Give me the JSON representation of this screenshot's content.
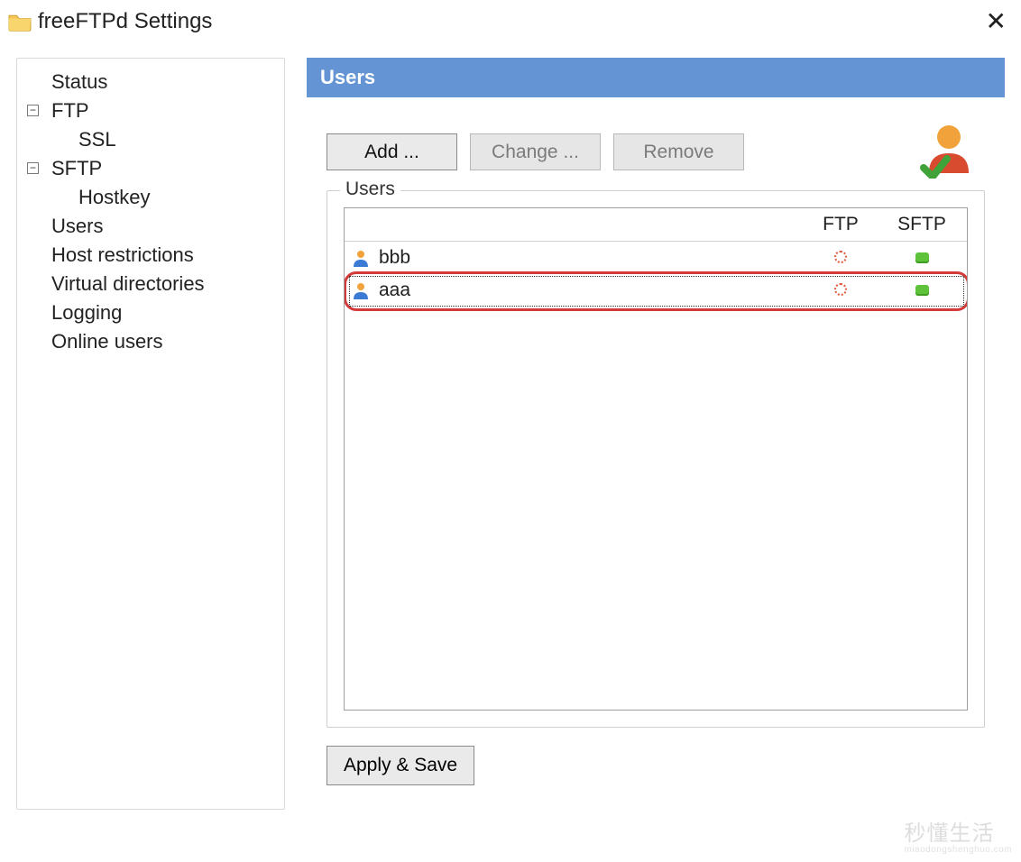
{
  "window": {
    "title": "freeFTPd Settings"
  },
  "sidebar": {
    "items": [
      {
        "label": "Status",
        "depth": 0,
        "expandable": false
      },
      {
        "label": "FTP",
        "depth": 0,
        "expandable": true,
        "expanded": true
      },
      {
        "label": "SSL",
        "depth": 1,
        "expandable": false
      },
      {
        "label": "SFTP",
        "depth": 0,
        "expandable": true,
        "expanded": true
      },
      {
        "label": "Hostkey",
        "depth": 1,
        "expandable": false
      },
      {
        "label": "Users",
        "depth": 0,
        "expandable": false,
        "selected": true
      },
      {
        "label": "Host restrictions",
        "depth": 0,
        "expandable": false
      },
      {
        "label": "Virtual directories",
        "depth": 0,
        "expandable": false
      },
      {
        "label": "Logging",
        "depth": 0,
        "expandable": false
      },
      {
        "label": "Online users",
        "depth": 0,
        "expandable": false
      }
    ]
  },
  "main": {
    "header": "Users",
    "buttons": {
      "add": "Add ...",
      "change": "Change ...",
      "remove": "Remove"
    },
    "group_label": "Users",
    "columns": {
      "name": "",
      "ftp": "FTP",
      "sftp": "SFTP"
    },
    "users": [
      {
        "name": "bbb",
        "ftp": false,
        "sftp": true,
        "selected": false
      },
      {
        "name": "aaa",
        "ftp": false,
        "sftp": true,
        "selected": true
      }
    ],
    "apply_label": "Apply & Save"
  },
  "watermark": {
    "main": "秒懂生活",
    "sub": "miaodongshenghuo.com"
  }
}
